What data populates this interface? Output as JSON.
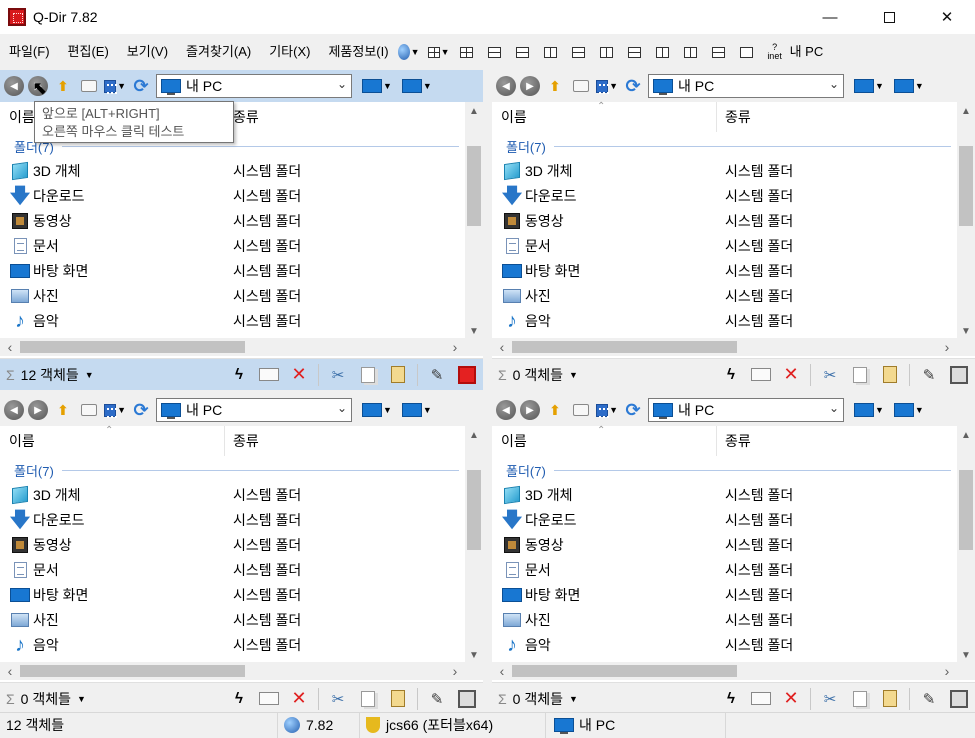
{
  "window": {
    "title": "Q-Dir 7.82",
    "minimize": "—",
    "maximize": "",
    "close": "✕"
  },
  "menu": {
    "items": [
      "파일(F)",
      "편집(E)",
      "보기(V)",
      "즐겨찾기(A)",
      "기타(X)",
      "제품정보(I)"
    ],
    "my_pc": "내 PC",
    "inet": "inet"
  },
  "tooltip": {
    "line1": "앞으로 [ALT+RIGHT]",
    "line2": "오른쪽 마우스 클릭 테스트"
  },
  "panes": [
    {
      "address": "내 PC",
      "col_name": "이름",
      "col_type": "종류",
      "group": "폴더(7)",
      "status": "12 객체들",
      "active": true,
      "rows": [
        {
          "name": "3D 개체",
          "type": "시스템 폴더",
          "icon": "3d-objects-icon"
        },
        {
          "name": "다운로드",
          "type": "시스템 폴더",
          "icon": "download-icon"
        },
        {
          "name": "동영상",
          "type": "시스템 폴더",
          "icon": "video-icon"
        },
        {
          "name": "문서",
          "type": "시스템 폴더",
          "icon": "document-icon"
        },
        {
          "name": "바탕 화면",
          "type": "시스템 폴더",
          "icon": "desktop-icon"
        },
        {
          "name": "사진",
          "type": "시스템 폴더",
          "icon": "pictures-icon"
        },
        {
          "name": "음악",
          "type": "시스템 폴더",
          "icon": "music-icon"
        }
      ]
    },
    {
      "address": "내 PC",
      "col_name": "이름",
      "col_type": "종류",
      "group": "폴더(7)",
      "status": "0 객체들",
      "active": false,
      "rows": [
        {
          "name": "3D 개체",
          "type": "시스템 폴더",
          "icon": "3d-objects-icon"
        },
        {
          "name": "다운로드",
          "type": "시스템 폴더",
          "icon": "download-icon"
        },
        {
          "name": "동영상",
          "type": "시스템 폴더",
          "icon": "video-icon"
        },
        {
          "name": "문서",
          "type": "시스템 폴더",
          "icon": "document-icon"
        },
        {
          "name": "바탕 화면",
          "type": "시스템 폴더",
          "icon": "desktop-icon"
        },
        {
          "name": "사진",
          "type": "시스템 폴더",
          "icon": "pictures-icon"
        },
        {
          "name": "음악",
          "type": "시스템 폴더",
          "icon": "music-icon"
        }
      ]
    },
    {
      "address": "내 PC",
      "col_name": "이름",
      "col_type": "종류",
      "group": "폴더(7)",
      "status": "0 객체들",
      "active": false,
      "rows": [
        {
          "name": "3D 개체",
          "type": "시스템 폴더",
          "icon": "3d-objects-icon"
        },
        {
          "name": "다운로드",
          "type": "시스템 폴더",
          "icon": "download-icon"
        },
        {
          "name": "동영상",
          "type": "시스템 폴더",
          "icon": "video-icon"
        },
        {
          "name": "문서",
          "type": "시스템 폴더",
          "icon": "document-icon"
        },
        {
          "name": "바탕 화면",
          "type": "시스템 폴더",
          "icon": "desktop-icon"
        },
        {
          "name": "사진",
          "type": "시스템 폴더",
          "icon": "pictures-icon"
        },
        {
          "name": "음악",
          "type": "시스템 폴더",
          "icon": "music-icon"
        }
      ]
    },
    {
      "address": "내 PC",
      "col_name": "이름",
      "col_type": "종류",
      "group": "폴더(7)",
      "status": "0 객체들",
      "active": false,
      "rows": [
        {
          "name": "3D 개체",
          "type": "시스템 폴더",
          "icon": "3d-objects-icon"
        },
        {
          "name": "다운로드",
          "type": "시스템 폴더",
          "icon": "download-icon"
        },
        {
          "name": "동영상",
          "type": "시스템 폴더",
          "icon": "video-icon"
        },
        {
          "name": "문서",
          "type": "시스템 폴더",
          "icon": "document-icon"
        },
        {
          "name": "바탕 화면",
          "type": "시스템 폴더",
          "icon": "desktop-icon"
        },
        {
          "name": "사진",
          "type": "시스템 폴더",
          "icon": "pictures-icon"
        },
        {
          "name": "음악",
          "type": "시스템 폴더",
          "icon": "music-icon"
        }
      ]
    }
  ],
  "statusbar": {
    "count": "12 객체들",
    "version": "7.82",
    "user": "jcs66 (포터블x64)",
    "location": "내 PC"
  },
  "colors": {
    "active_pane": "#c5daf0",
    "group_text": "#1e5bb0",
    "delete_red": "#e02020"
  }
}
